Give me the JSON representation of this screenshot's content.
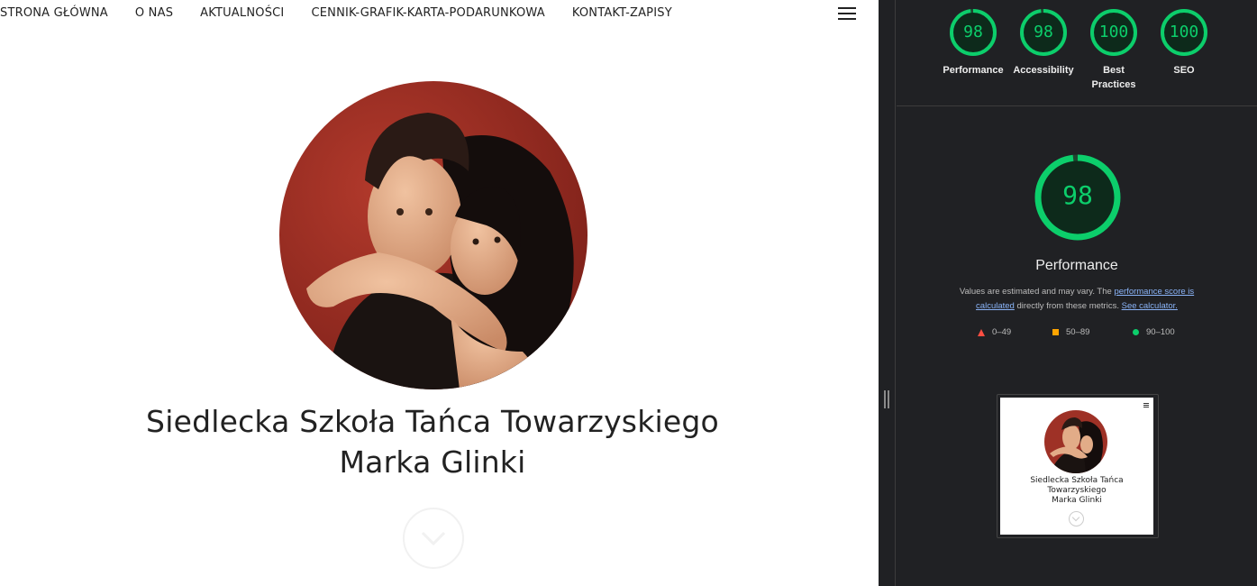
{
  "site": {
    "nav": [
      "STRONA GŁÓWNA",
      "O NAS",
      "AKTUALNOŚCI",
      "CENNIK-GRAFIK-KARTA-PODARUNKOWA",
      "KONTAKT-ZAPISY"
    ],
    "menu_icon": "hamburger-menu-icon",
    "hero_title_line1": "Siedlecka Szkoła Tańca Towarzyskiego",
    "hero_title_line2": "Marka Glinki",
    "scroll_icon": "chevron-down-circle-icon"
  },
  "lighthouse": {
    "scores": [
      {
        "score": "98",
        "label": "Performance",
        "value": 0.98
      },
      {
        "score": "98",
        "label": "Accessibility",
        "value": 0.98
      },
      {
        "score": "100",
        "label": "Best Practices",
        "value": 1.0
      },
      {
        "score": "100",
        "label": "SEO",
        "value": 1.0
      }
    ],
    "main_score": "98",
    "main_value": 0.98,
    "main_title": "Performance",
    "note_prefix": "Values are estimated and may vary. The ",
    "note_link1": "performance score is calculated",
    "note_middle": " directly from these metrics. ",
    "note_link2": "See calculator.",
    "legend": [
      {
        "range": "0–49",
        "shape": "triangle",
        "color": "#ff4e42"
      },
      {
        "range": "50–89",
        "shape": "square",
        "color": "#ffa400"
      },
      {
        "range": "90–100",
        "shape": "circle",
        "color": "#0cce6b"
      }
    ],
    "thumbnail": {
      "title_line1": "Siedlecka Szkoła Tańca",
      "title_line2": "Towarzyskiego",
      "title_line3": "Marka Glinki"
    }
  },
  "colors": {
    "pass_green": "#0cce6b",
    "devtools_bg": "#202124",
    "link_blue": "#8ab4f8"
  }
}
